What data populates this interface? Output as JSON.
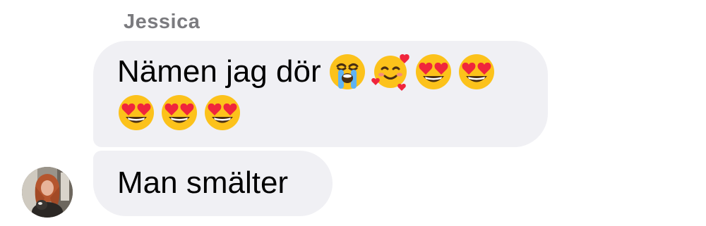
{
  "thread": {
    "sender_name": "Jessica",
    "messages": [
      {
        "text_line_1": "Nämen jag dör",
        "emojis_line_1": [
          "loudly-crying-face-emoji",
          "smiling-face-with-hearts-emoji",
          "heart-eyes-emoji",
          "heart-eyes-emoji"
        ],
        "emojis_line_2": [
          "heart-eyes-emoji",
          "heart-eyes-emoji",
          "heart-eyes-emoji"
        ]
      },
      {
        "text": "Man smälter"
      }
    ]
  },
  "colors": {
    "bubble_background": "#f0f0f4",
    "sender_name": "#7b7b7f",
    "message_text": "#000000",
    "emoji_face": "#fcc21b",
    "heart": "#f0253c"
  }
}
